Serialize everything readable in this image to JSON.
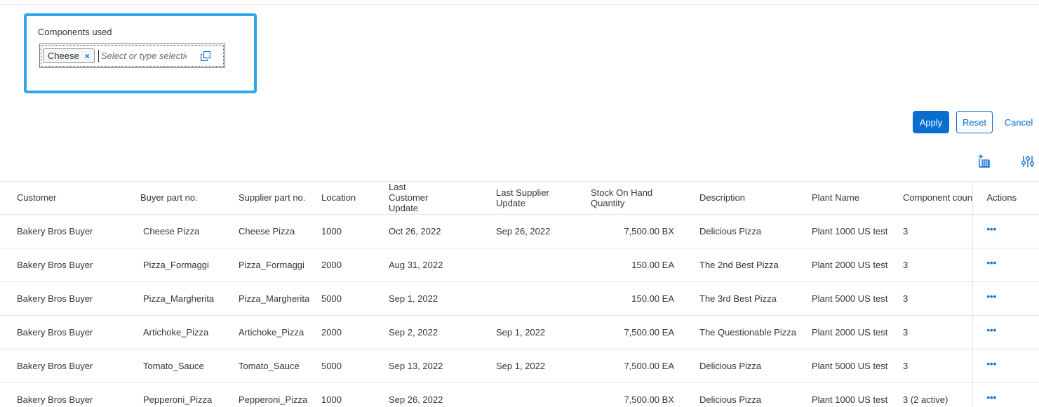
{
  "filter": {
    "label": "Components used",
    "token": "Cheese",
    "token_remove": "×",
    "placeholder": "Select or type selection"
  },
  "buttons": {
    "apply": "Apply",
    "reset": "Reset",
    "cancel": "Cancel"
  },
  "colors": {
    "accent": "#0a6ed1",
    "highlight_border": "#2ea6e8"
  },
  "icons": {
    "value_help": "value-help-icon",
    "export": "export-to-spreadsheet-icon",
    "settings": "table-settings-icon",
    "row_actions": "more-actions-icon"
  },
  "table": {
    "headers": {
      "customer": "Customer",
      "buyer_part": "Buyer part no.",
      "supplier_part": "Supplier part no.",
      "location": "Location",
      "last_customer_update": "Last Customer Update",
      "last_supplier_update": "Last Supplier Update",
      "stock": "Stock On Hand Quantity",
      "description": "Description",
      "plant": "Plant Name",
      "component_count": "Component count",
      "actions": "Actions"
    },
    "row_action_label": "•••",
    "rows": [
      {
        "customer": "Bakery Bros Buyer",
        "buyer_part": "Cheese Pizza",
        "supplier_part": "Cheese Pizza",
        "location": "1000",
        "last_customer_update": "Oct 26, 2022",
        "last_supplier_update": "Sep 26, 2022",
        "stock": "7,500.00 BX",
        "description": "Delicious Pizza",
        "plant": "Plant 1000 US test",
        "component_count": "3"
      },
      {
        "customer": "Bakery Bros Buyer",
        "buyer_part": "Pizza_Formaggi",
        "supplier_part": "Pizza_Formaggi",
        "location": "2000",
        "last_customer_update": "Aug 31, 2022",
        "last_supplier_update": "",
        "stock": "150.00 EA",
        "description": "The 2nd Best Pizza",
        "plant": "Plant 2000 US test",
        "component_count": "3"
      },
      {
        "customer": "Bakery Bros Buyer",
        "buyer_part": "Pizza_Margherita",
        "supplier_part": "Pizza_Margherita",
        "location": "5000",
        "last_customer_update": "Sep 1, 2022",
        "last_supplier_update": "",
        "stock": "150.00 EA",
        "description": "The 3rd Best Pizza",
        "plant": "Plant 5000 US test",
        "component_count": "3"
      },
      {
        "customer": "Bakery Bros Buyer",
        "buyer_part": "Artichoke_Pizza",
        "supplier_part": "Artichoke_Pizza",
        "location": "2000",
        "last_customer_update": "Sep 2, 2022",
        "last_supplier_update": "Sep 1, 2022",
        "stock": "7,500.00 EA",
        "description": "The Questionable Pizza",
        "plant": "Plant 2000 US test",
        "component_count": "3"
      },
      {
        "customer": "Bakery Bros Buyer",
        "buyer_part": "Tomato_Sauce",
        "supplier_part": "Tomato_Sauce",
        "location": "5000",
        "last_customer_update": "Sep 13, 2022",
        "last_supplier_update": "Sep 1, 2022",
        "stock": "7,500.00 EA",
        "description": "Delicious Pizza",
        "plant": "Plant 5000 US test",
        "component_count": "3"
      },
      {
        "customer": "Bakery Bros Buyer",
        "buyer_part": "Pepperoni_Pizza",
        "supplier_part": "Pepperoni_Pizza",
        "location": "1000",
        "last_customer_update": "Sep 26, 2022",
        "last_supplier_update": "",
        "stock": "7,500.00 BX",
        "description": "Delicious Pizza",
        "plant": "Plant 1000 US test",
        "component_count": "3 (2 active)"
      }
    ]
  }
}
